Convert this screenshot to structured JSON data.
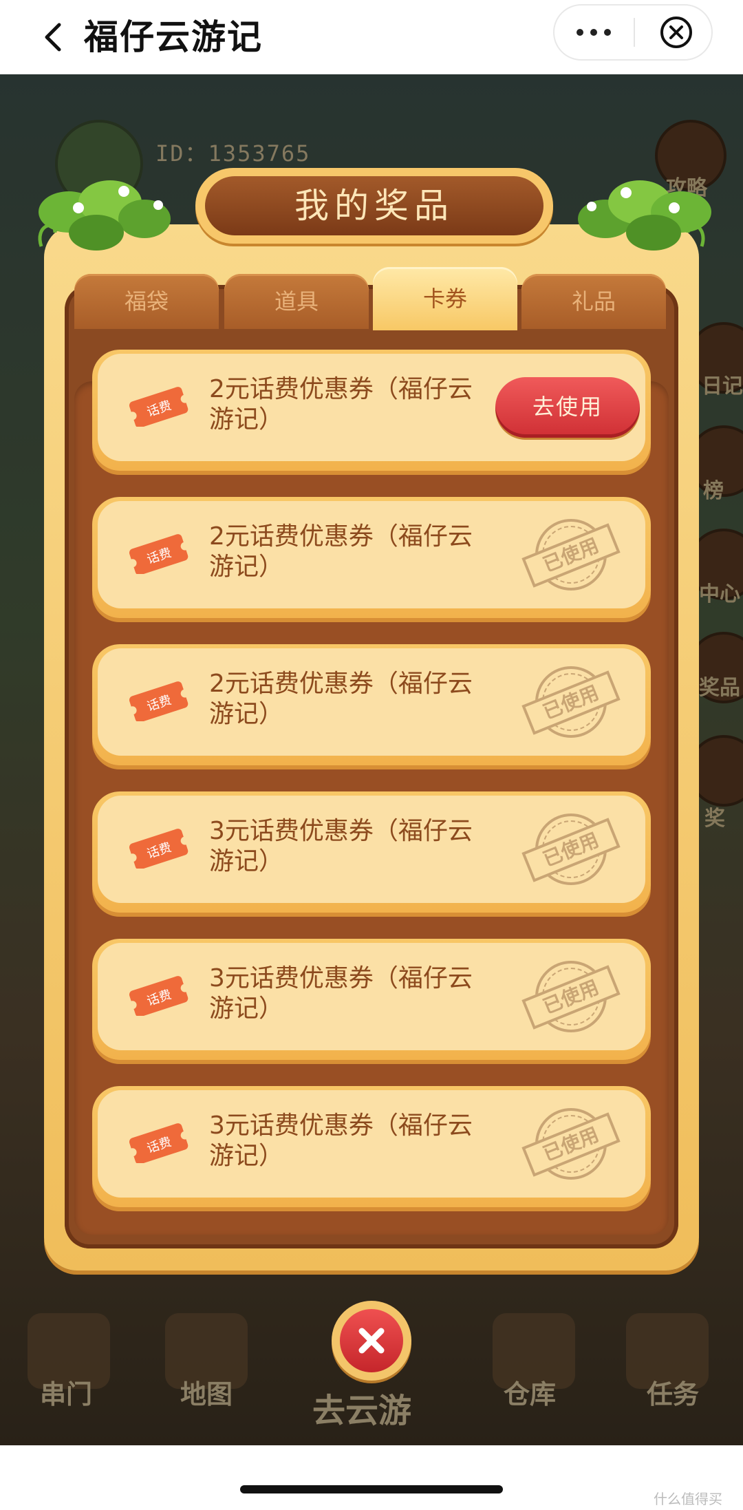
{
  "header": {
    "title": "福仔云游记"
  },
  "game": {
    "id_label": "ID：1353765",
    "side_buttons": [
      "攻略",
      "日记",
      "榜",
      "中心",
      "奖品",
      "奖"
    ],
    "nav": [
      "串门",
      "地图",
      "去云游",
      "仓库",
      "任务"
    ]
  },
  "modal": {
    "title": "我的奖品",
    "tabs": [
      "福袋",
      "道具",
      "卡券",
      "礼品"
    ],
    "active_tab": "卡券",
    "ticket_label": "话费",
    "items": [
      {
        "title": "2元话费优惠券（福仔云游记）",
        "action": "去使用"
      },
      {
        "title": "2元话费优惠券（福仔云游记）",
        "status": "已使用"
      },
      {
        "title": "2元话费优惠券（福仔云游记）",
        "status": "已使用"
      },
      {
        "title": "3元话费优惠券（福仔云游记）",
        "status": "已使用"
      },
      {
        "title": "3元话费优惠券（福仔云游记）",
        "status": "已使用"
      },
      {
        "title": "3元话费优惠券（福仔云游记）",
        "status": "已使用"
      }
    ]
  },
  "watermark": "什么值得买"
}
